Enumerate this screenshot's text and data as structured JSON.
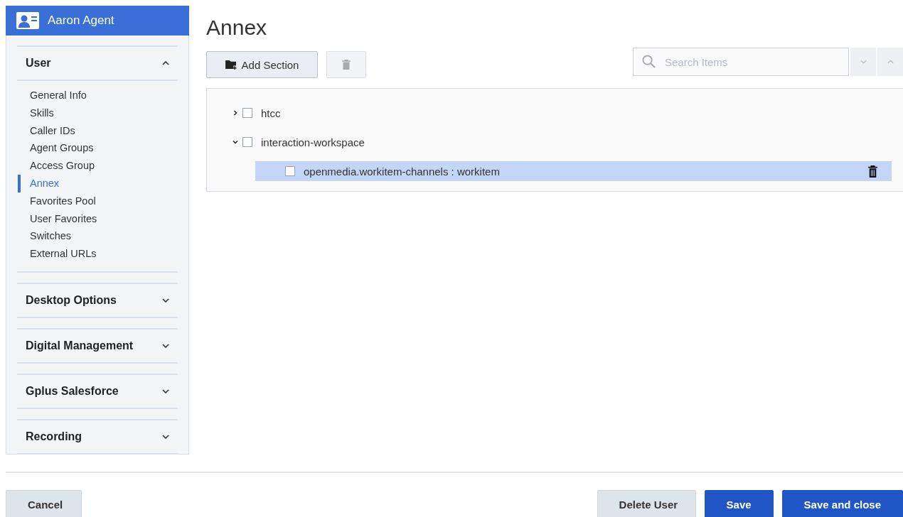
{
  "sidebar": {
    "title": "Aaron Agent",
    "sections": [
      {
        "title": "User",
        "expanded": true,
        "items": [
          {
            "label": "General Info",
            "selected": false
          },
          {
            "label": "Skills",
            "selected": false
          },
          {
            "label": "Caller IDs",
            "selected": false
          },
          {
            "label": "Agent Groups",
            "selected": false
          },
          {
            "label": "Access Group",
            "selected": false
          },
          {
            "label": "Annex",
            "selected": true
          },
          {
            "label": "Favorites Pool",
            "selected": false
          },
          {
            "label": "User Favorites",
            "selected": false
          },
          {
            "label": "Switches",
            "selected": false
          },
          {
            "label": "External URLs",
            "selected": false
          }
        ]
      },
      {
        "title": "Desktop Options",
        "expanded": false
      },
      {
        "title": "Digital Management",
        "expanded": false
      },
      {
        "title": "Gplus Salesforce",
        "expanded": false
      },
      {
        "title": "Recording",
        "expanded": false
      }
    ]
  },
  "page_title": "Annex",
  "toolbar": {
    "add_button": "Add Section",
    "search": {
      "placeholder": "Search Items"
    }
  },
  "tree": [
    {
      "label": "htcc",
      "expanded": false,
      "checked": false,
      "selected": false
    },
    {
      "label": "interaction-workspace",
      "expanded": true,
      "checked": false,
      "selected": false,
      "children": [
        {
          "label": "openmedia.workitem-channels : workitem",
          "checked": false,
          "selected": true
        }
      ]
    }
  ],
  "footer": {
    "left_buttons": [
      {
        "label": "Cancel",
        "kind": "secondary"
      }
    ],
    "right_buttons": [
      {
        "label": "Delete User",
        "kind": "secondary"
      },
      {
        "label": "Save",
        "kind": "primary"
      },
      {
        "label": "Save and close",
        "kind": "primary"
      }
    ]
  }
}
